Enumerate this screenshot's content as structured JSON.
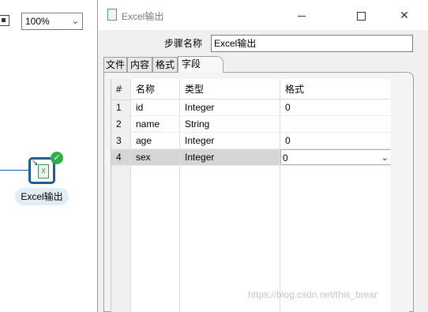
{
  "toolbar": {
    "zoom_value": "100%",
    "zoom_icon": "chevron-down-icon"
  },
  "canvas": {
    "step_label": "Excel输出",
    "step_icon": "excel-output-icon",
    "status": "success-check-icon",
    "hop_color": "#1b5aa8"
  },
  "dialog": {
    "title": "Excel输出",
    "controls": {
      "minimize": "minimize-icon",
      "maximize": "maximize-icon",
      "close": "close-icon"
    },
    "step_name_label": "步骤名称",
    "step_name_value": "Excel输出",
    "tabs": [
      {
        "label": "文件",
        "active": false
      },
      {
        "label": "内容",
        "active": false
      },
      {
        "label": "格式",
        "active": false
      },
      {
        "label": "字段",
        "active": true
      }
    ],
    "table": {
      "headers": {
        "num": "#",
        "name": "名称",
        "type": "类型",
        "format": "格式"
      },
      "rows": [
        {
          "num": "1",
          "name": "id",
          "type": "Integer",
          "format": "0"
        },
        {
          "num": "2",
          "name": "name",
          "type": "String",
          "format": ""
        },
        {
          "num": "3",
          "name": "age",
          "type": "Integer",
          "format": "0"
        },
        {
          "num": "4",
          "name": "sex",
          "type": "Integer",
          "format": "0",
          "selected": true
        }
      ],
      "selected_row_color": "#d6d6d6"
    }
  },
  "watermark": "https://blog.csdn.net/this_brear"
}
